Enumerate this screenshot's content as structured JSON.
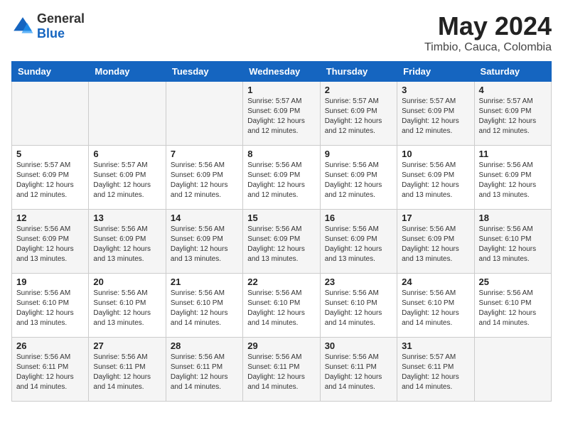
{
  "header": {
    "logo_general": "General",
    "logo_blue": "Blue",
    "month": "May 2024",
    "location": "Timbio, Cauca, Colombia"
  },
  "days_of_week": [
    "Sunday",
    "Monday",
    "Tuesday",
    "Wednesday",
    "Thursday",
    "Friday",
    "Saturday"
  ],
  "weeks": [
    [
      {
        "day": "",
        "info": ""
      },
      {
        "day": "",
        "info": ""
      },
      {
        "day": "",
        "info": ""
      },
      {
        "day": "1",
        "info": "Sunrise: 5:57 AM\nSunset: 6:09 PM\nDaylight: 12 hours and 12 minutes."
      },
      {
        "day": "2",
        "info": "Sunrise: 5:57 AM\nSunset: 6:09 PM\nDaylight: 12 hours and 12 minutes."
      },
      {
        "day": "3",
        "info": "Sunrise: 5:57 AM\nSunset: 6:09 PM\nDaylight: 12 hours and 12 minutes."
      },
      {
        "day": "4",
        "info": "Sunrise: 5:57 AM\nSunset: 6:09 PM\nDaylight: 12 hours and 12 minutes."
      }
    ],
    [
      {
        "day": "5",
        "info": "Sunrise: 5:57 AM\nSunset: 6:09 PM\nDaylight: 12 hours and 12 minutes."
      },
      {
        "day": "6",
        "info": "Sunrise: 5:57 AM\nSunset: 6:09 PM\nDaylight: 12 hours and 12 minutes."
      },
      {
        "day": "7",
        "info": "Sunrise: 5:56 AM\nSunset: 6:09 PM\nDaylight: 12 hours and 12 minutes."
      },
      {
        "day": "8",
        "info": "Sunrise: 5:56 AM\nSunset: 6:09 PM\nDaylight: 12 hours and 12 minutes."
      },
      {
        "day": "9",
        "info": "Sunrise: 5:56 AM\nSunset: 6:09 PM\nDaylight: 12 hours and 12 minutes."
      },
      {
        "day": "10",
        "info": "Sunrise: 5:56 AM\nSunset: 6:09 PM\nDaylight: 12 hours and 13 minutes."
      },
      {
        "day": "11",
        "info": "Sunrise: 5:56 AM\nSunset: 6:09 PM\nDaylight: 12 hours and 13 minutes."
      }
    ],
    [
      {
        "day": "12",
        "info": "Sunrise: 5:56 AM\nSunset: 6:09 PM\nDaylight: 12 hours and 13 minutes."
      },
      {
        "day": "13",
        "info": "Sunrise: 5:56 AM\nSunset: 6:09 PM\nDaylight: 12 hours and 13 minutes."
      },
      {
        "day": "14",
        "info": "Sunrise: 5:56 AM\nSunset: 6:09 PM\nDaylight: 12 hours and 13 minutes."
      },
      {
        "day": "15",
        "info": "Sunrise: 5:56 AM\nSunset: 6:09 PM\nDaylight: 12 hours and 13 minutes."
      },
      {
        "day": "16",
        "info": "Sunrise: 5:56 AM\nSunset: 6:09 PM\nDaylight: 12 hours and 13 minutes."
      },
      {
        "day": "17",
        "info": "Sunrise: 5:56 AM\nSunset: 6:09 PM\nDaylight: 12 hours and 13 minutes."
      },
      {
        "day": "18",
        "info": "Sunrise: 5:56 AM\nSunset: 6:10 PM\nDaylight: 12 hours and 13 minutes."
      }
    ],
    [
      {
        "day": "19",
        "info": "Sunrise: 5:56 AM\nSunset: 6:10 PM\nDaylight: 12 hours and 13 minutes."
      },
      {
        "day": "20",
        "info": "Sunrise: 5:56 AM\nSunset: 6:10 PM\nDaylight: 12 hours and 13 minutes."
      },
      {
        "day": "21",
        "info": "Sunrise: 5:56 AM\nSunset: 6:10 PM\nDaylight: 12 hours and 14 minutes."
      },
      {
        "day": "22",
        "info": "Sunrise: 5:56 AM\nSunset: 6:10 PM\nDaylight: 12 hours and 14 minutes."
      },
      {
        "day": "23",
        "info": "Sunrise: 5:56 AM\nSunset: 6:10 PM\nDaylight: 12 hours and 14 minutes."
      },
      {
        "day": "24",
        "info": "Sunrise: 5:56 AM\nSunset: 6:10 PM\nDaylight: 12 hours and 14 minutes."
      },
      {
        "day": "25",
        "info": "Sunrise: 5:56 AM\nSunset: 6:10 PM\nDaylight: 12 hours and 14 minutes."
      }
    ],
    [
      {
        "day": "26",
        "info": "Sunrise: 5:56 AM\nSunset: 6:11 PM\nDaylight: 12 hours and 14 minutes."
      },
      {
        "day": "27",
        "info": "Sunrise: 5:56 AM\nSunset: 6:11 PM\nDaylight: 12 hours and 14 minutes."
      },
      {
        "day": "28",
        "info": "Sunrise: 5:56 AM\nSunset: 6:11 PM\nDaylight: 12 hours and 14 minutes."
      },
      {
        "day": "29",
        "info": "Sunrise: 5:56 AM\nSunset: 6:11 PM\nDaylight: 12 hours and 14 minutes."
      },
      {
        "day": "30",
        "info": "Sunrise: 5:56 AM\nSunset: 6:11 PM\nDaylight: 12 hours and 14 minutes."
      },
      {
        "day": "31",
        "info": "Sunrise: 5:57 AM\nSunset: 6:11 PM\nDaylight: 12 hours and 14 minutes."
      },
      {
        "day": "",
        "info": ""
      }
    ]
  ]
}
